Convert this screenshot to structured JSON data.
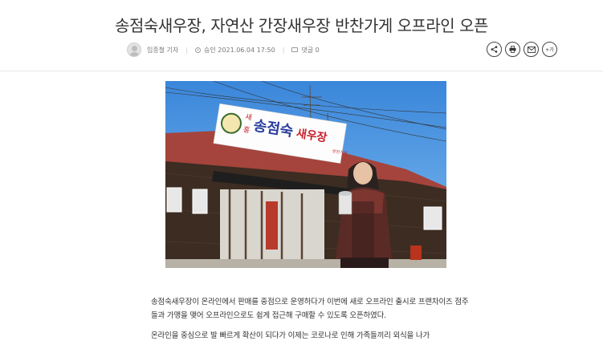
{
  "article": {
    "title": "송점숙새우장, 자연산 간장새우장 반찬가게 오프라인 오픈",
    "author": "임종철 기자",
    "published": "승인 2021.06.04 17:50",
    "comments": "댓글 0"
  },
  "actions": {
    "icons": [
      "share-icon",
      "print-icon",
      "email-icon",
      "font-size-icon"
    ],
    "font_label": "+가"
  },
  "photo": {
    "sign_main": "송점숙",
    "sign_accent": "새우장",
    "sign_left_top": "새",
    "sign_left_bottom": "홍",
    "sign_side": "반찬가게",
    "colors": {
      "sky": "#3d8fe0",
      "roof": "#a5443c",
      "wall": "#3c2c22",
      "sign_red": "#c8202a",
      "sign_blue": "#2a3d9c"
    }
  },
  "body": {
    "paragraph_1": "송점숙새우장이 온라인에서 판매를 중점으로 운영하다가 이번에 새로 오프라인 출시로 프랜차이즈 점주들과 가맹을 맺어 오프라인으로도 쉽게 접근해 구매할 수 있도록 오픈하였다.",
    "paragraph_2": "온라인을 중심으로 발 빠르게 확산이 되다가 이제는 코로나로 인해 가족들끼리 외식을 나가"
  }
}
